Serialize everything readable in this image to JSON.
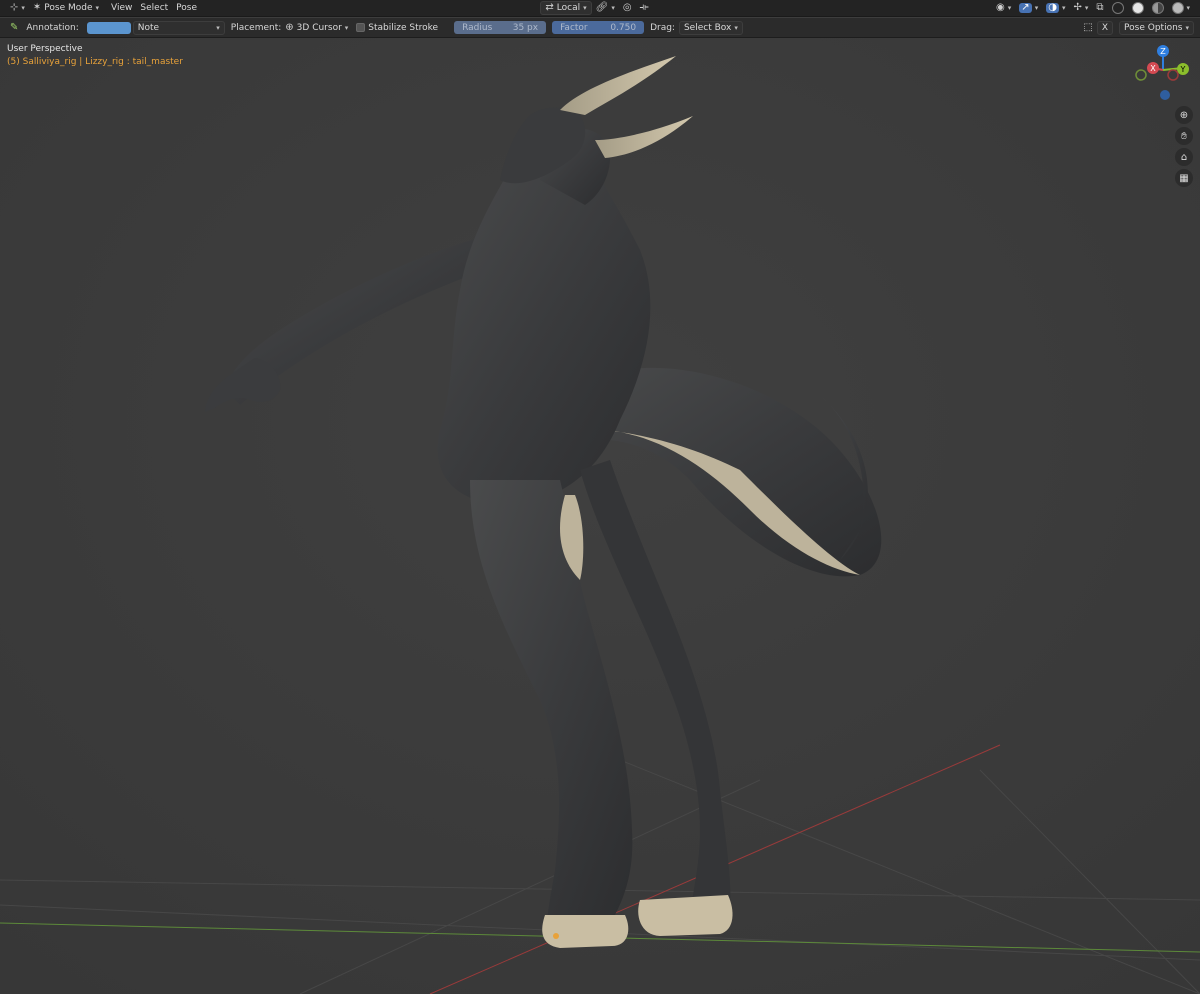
{
  "header": {
    "mode": "Pose Mode",
    "menus": [
      "View",
      "Select",
      "Pose"
    ],
    "orientation": "Local"
  },
  "toolbar": {
    "annotation_label": "Annotation:",
    "color_hex": "#5b95cf",
    "note": "Note",
    "placement_label": "Placement:",
    "placement_value": "3D Cursor",
    "stabilize_label": "Stabilize Stroke",
    "radius_label": "Radius",
    "radius_value": "35 px",
    "factor_label": "Factor",
    "factor_value": "0.750",
    "drag_label": "Drag:",
    "drag_value": "Select Box",
    "x_label": "X",
    "pose_options": "Pose Options"
  },
  "viewport": {
    "perspective": "User Perspective",
    "object_info": "(5) Salliviya_rig | Lizzy_rig : tail_master"
  },
  "gizmo": {
    "z": "Z",
    "x": "X",
    "y": "Y",
    "colors": {
      "x": "#d44a52",
      "y": "#8bbe2c",
      "z": "#2f7fe0"
    }
  },
  "icons": [
    "editor-type-icon",
    "pose-mode-icon",
    "transform-pivot-icon",
    "snap-link-icon",
    "proportional-icon",
    "mirror-icon",
    "visibility-icon",
    "gizmo-icon",
    "overlay-icon",
    "xray-icon",
    "shading-wireframe-icon",
    "shading-solid-icon",
    "shading-material-icon",
    "shading-rendered-icon",
    "zoom-icon",
    "pan-hand-icon",
    "camera-icon",
    "grid-icon"
  ]
}
